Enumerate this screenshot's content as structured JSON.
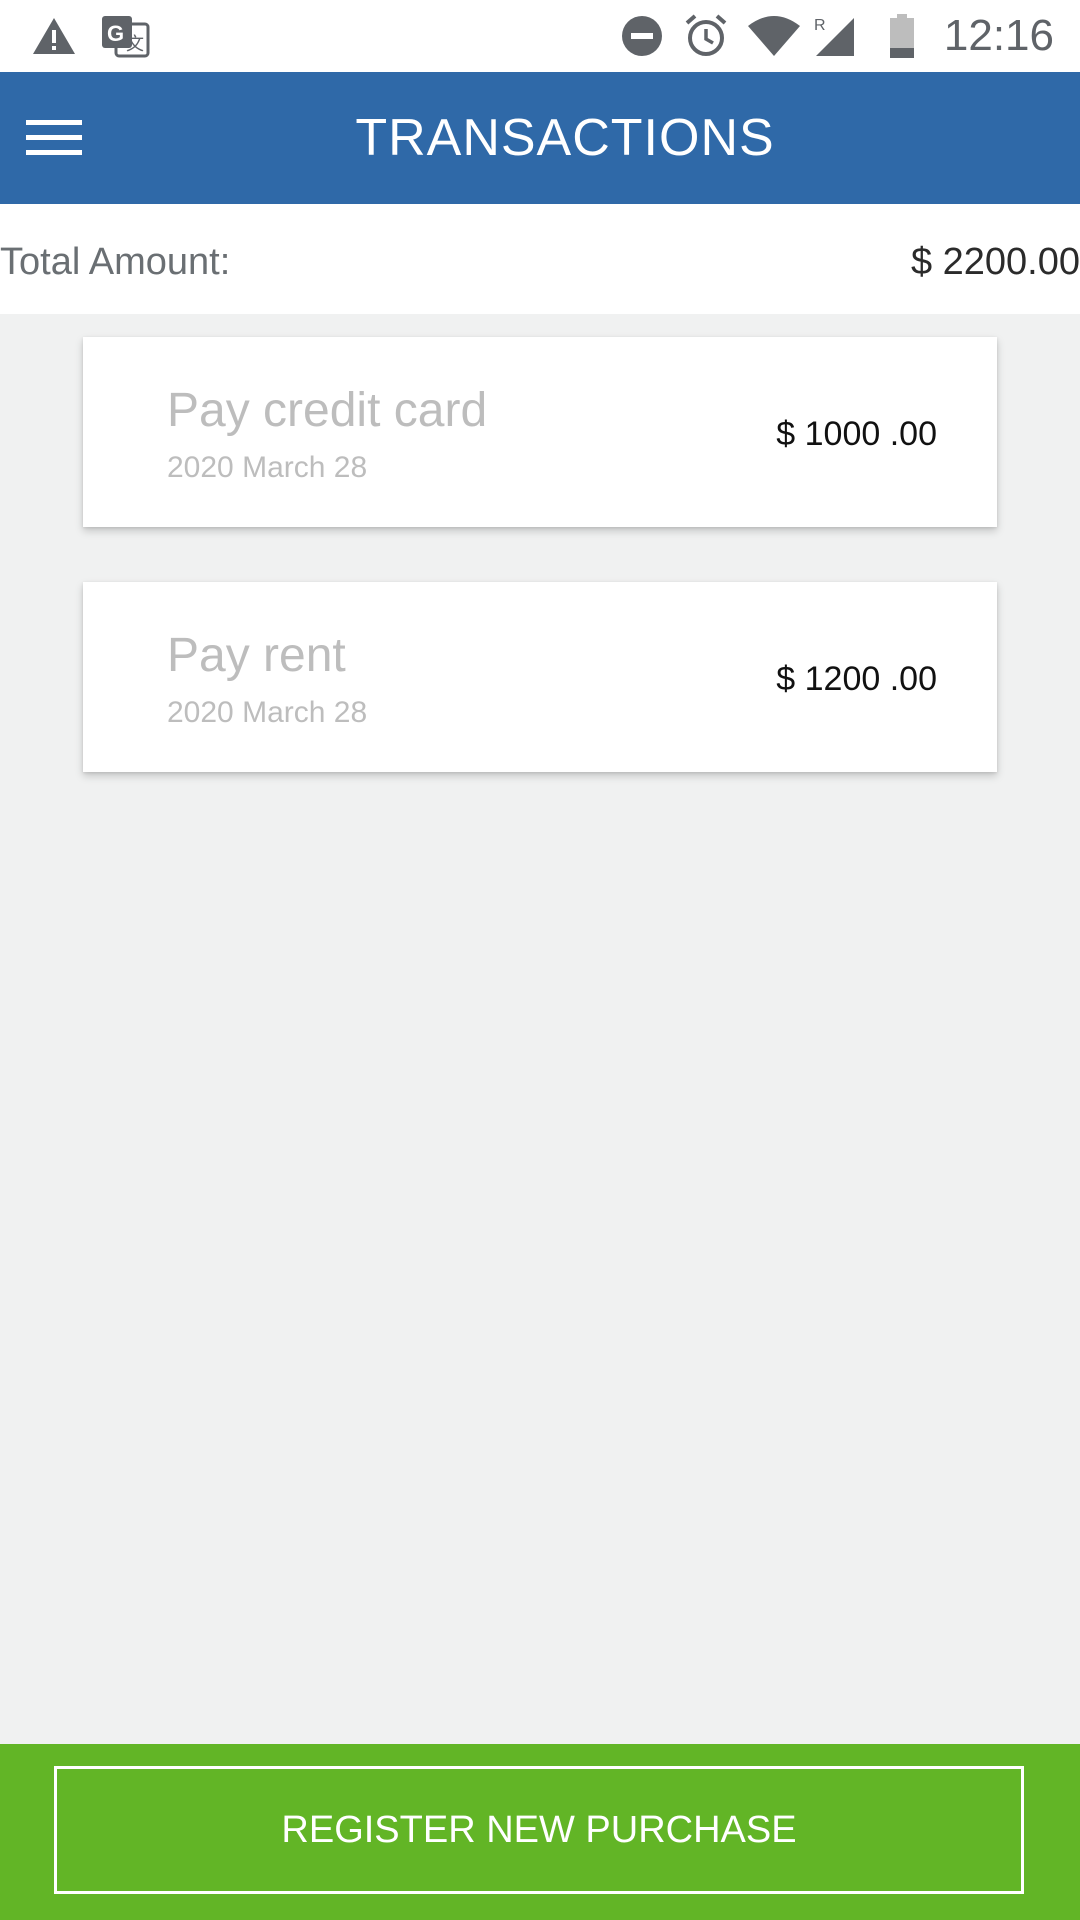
{
  "status_bar": {
    "time": "12:16",
    "icons": [
      "warning-icon",
      "translate-icon",
      "do-not-disturb-icon",
      "alarm-icon",
      "wifi-icon",
      "signal-roaming-icon",
      "battery-icon"
    ]
  },
  "app_bar": {
    "title": "TRANSACTIONS",
    "menu_icon": "hamburger-menu-icon"
  },
  "summary": {
    "total_label": "Total Amount:",
    "total_value": "$ 2200.00"
  },
  "transactions": [
    {
      "title": "Pay credit card",
      "date": "2020 March 28",
      "amount": "$ 1000 .00"
    },
    {
      "title": "Pay rent",
      "date": "2020 March 28",
      "amount": "$ 1200 .00"
    }
  ],
  "actions": {
    "register_label": "REGISTER NEW PURCHASE"
  },
  "colors": {
    "app_bar": "#2f69a8",
    "bottom_bar": "#62b526",
    "background": "#f0f1f1"
  }
}
